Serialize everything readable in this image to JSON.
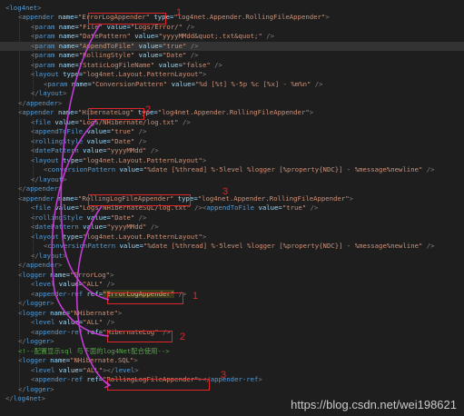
{
  "code_lines": [
    {
      "parts": [
        [
          "t",
          "<"
        ],
        [
          "n",
          "log4net"
        ],
        [
          "t",
          ">"
        ]
      ]
    },
    {
      "parts": [
        [
          "t",
          "<"
        ],
        [
          "n",
          "appender"
        ],
        [
          "a",
          " name="
        ],
        [
          "v",
          "\"ErrorLogAppender\""
        ],
        [
          "a",
          " type="
        ],
        [
          "v",
          "\"log4net.Appender.RollingFileAppender\""
        ],
        [
          "t",
          ">"
        ]
      ]
    },
    {
      "parts": [
        [
          "t",
          "<"
        ],
        [
          "n",
          "param"
        ],
        [
          "a",
          " name="
        ],
        [
          "v",
          "\"File\""
        ],
        [
          "a",
          " value="
        ],
        [
          "v",
          "\"Logs/Error/\""
        ],
        [
          "t",
          " />"
        ]
      ]
    },
    {
      "parts": [
        [
          "t",
          "<"
        ],
        [
          "n",
          "param"
        ],
        [
          "a",
          " name="
        ],
        [
          "v",
          "\"DatePattern\""
        ],
        [
          "a",
          " value="
        ],
        [
          "v",
          "\"yyyyMMdd&quot;.txt&quot;\""
        ],
        [
          "t",
          " />"
        ]
      ]
    },
    {
      "parts": [
        [
          "t",
          "<"
        ],
        [
          "n",
          "param"
        ],
        [
          "a",
          " name="
        ],
        [
          "v",
          "\"AppendToFile\""
        ],
        [
          "a",
          " value="
        ],
        [
          "v",
          "\"true\""
        ],
        [
          "t",
          " />"
        ]
      ]
    },
    {
      "parts": [
        [
          "t",
          "<"
        ],
        [
          "n",
          "param"
        ],
        [
          "a",
          " name="
        ],
        [
          "v",
          "\"RollingStyle\""
        ],
        [
          "a",
          " value="
        ],
        [
          "v",
          "\"Date\""
        ],
        [
          "t",
          " />"
        ]
      ]
    },
    {
      "parts": [
        [
          "t",
          "<"
        ],
        [
          "n",
          "param"
        ],
        [
          "a",
          " name="
        ],
        [
          "v",
          "\"StaticLogFileName\""
        ],
        [
          "a",
          " value="
        ],
        [
          "v",
          "\"false\""
        ],
        [
          "t",
          " />"
        ]
      ]
    },
    {
      "parts": [
        [
          "t",
          "<"
        ],
        [
          "n",
          "layout"
        ],
        [
          "a",
          " type="
        ],
        [
          "v",
          "\"log4net.Layout.PatternLayout\""
        ],
        [
          "t",
          ">"
        ]
      ]
    },
    {
      "parts": [
        [
          "t",
          "<"
        ],
        [
          "n",
          "param"
        ],
        [
          "a",
          " name="
        ],
        [
          "v",
          "\"ConversionPattern\""
        ],
        [
          "a",
          " value="
        ],
        [
          "v",
          "\"%d [%t] %-5p %c [%x] - %m%n\""
        ],
        [
          "t",
          " />"
        ]
      ]
    },
    {
      "parts": [
        [
          "t",
          "</"
        ],
        [
          "n",
          "layout"
        ],
        [
          "t",
          ">"
        ]
      ]
    },
    {
      "parts": [
        [
          "t",
          "</"
        ],
        [
          "n",
          "appender"
        ],
        [
          "t",
          ">"
        ]
      ]
    },
    {
      "parts": [
        [
          "t",
          "<"
        ],
        [
          "n",
          "appender"
        ],
        [
          "a",
          " name="
        ],
        [
          "v",
          "\"HibernateLog\""
        ],
        [
          "a",
          " type="
        ],
        [
          "v",
          "\"log4net.Appender.RollingFileAppender\""
        ],
        [
          "t",
          ">"
        ]
      ]
    },
    {
      "parts": [
        [
          "t",
          "<"
        ],
        [
          "n",
          "file"
        ],
        [
          "a",
          " value="
        ],
        [
          "v",
          "\"Logs/NHibernate/log.txt\""
        ],
        [
          "t",
          " />"
        ]
      ]
    },
    {
      "parts": [
        [
          "t",
          "<"
        ],
        [
          "n",
          "appendToFile"
        ],
        [
          "a",
          " value="
        ],
        [
          "v",
          "\"true\""
        ],
        [
          "t",
          " />"
        ]
      ]
    },
    {
      "parts": [
        [
          "t",
          "<"
        ],
        [
          "n",
          "rollingStyle"
        ],
        [
          "a",
          " value="
        ],
        [
          "v",
          "\"Date\""
        ],
        [
          "t",
          " />"
        ]
      ]
    },
    {
      "parts": [
        [
          "t",
          "<"
        ],
        [
          "n",
          "datePattern"
        ],
        [
          "a",
          " value="
        ],
        [
          "v",
          "\"yyyyMMdd\""
        ],
        [
          "t",
          " />"
        ]
      ]
    },
    {
      "parts": [
        [
          "t",
          "<"
        ],
        [
          "n",
          "layout"
        ],
        [
          "a",
          " type="
        ],
        [
          "v",
          "\"log4net.Layout.PatternLayout\""
        ],
        [
          "t",
          ">"
        ]
      ]
    },
    {
      "parts": [
        [
          "t",
          "<"
        ],
        [
          "n",
          "conversionPattern"
        ],
        [
          "a",
          " value="
        ],
        [
          "v",
          "\"%date [%thread] %-5level %logger [%property{NDC}] - %message%newline\""
        ],
        [
          "t",
          " />"
        ]
      ]
    },
    {
      "parts": [
        [
          "t",
          "</"
        ],
        [
          "n",
          "layout"
        ],
        [
          "t",
          ">"
        ]
      ]
    },
    {
      "parts": [
        [
          "t",
          "</"
        ],
        [
          "n",
          "appender"
        ],
        [
          "t",
          ">"
        ]
      ]
    },
    {
      "parts": [
        [
          "t",
          "<"
        ],
        [
          "n",
          "appender"
        ],
        [
          "a",
          " name="
        ],
        [
          "v",
          "\"RollingLogFileAppender\""
        ],
        [
          "a",
          " type="
        ],
        [
          "v",
          "\"log4net.Appender.RollingFileAppender\""
        ],
        [
          "t",
          ">"
        ]
      ]
    },
    {
      "parts": [
        [
          "t",
          "<"
        ],
        [
          "n",
          "file"
        ],
        [
          "a",
          " value="
        ],
        [
          "v",
          "\"Logs/NHibernateSQL/log.txt\""
        ],
        [
          "t",
          " /><"
        ],
        [
          "n",
          "appendToFile"
        ],
        [
          "a",
          " value="
        ],
        [
          "v",
          "\"true\""
        ],
        [
          "t",
          " />"
        ]
      ]
    },
    {
      "parts": [
        [
          "t",
          "<"
        ],
        [
          "n",
          "rollingStyle"
        ],
        [
          "a",
          " value="
        ],
        [
          "v",
          "\"Date\""
        ],
        [
          "t",
          " />"
        ]
      ]
    },
    {
      "parts": [
        [
          "t",
          "<"
        ],
        [
          "n",
          "datePattern"
        ],
        [
          "a",
          " value="
        ],
        [
          "v",
          "\"yyyyMMdd\""
        ],
        [
          "t",
          " />"
        ]
      ]
    },
    {
      "parts": [
        [
          "t",
          "<"
        ],
        [
          "n",
          "layout"
        ],
        [
          "a",
          " type="
        ],
        [
          "v",
          "\"log4net.Layout.PatternLayout\""
        ],
        [
          "t",
          ">"
        ]
      ]
    },
    {
      "parts": [
        [
          "t",
          "<"
        ],
        [
          "n",
          "conversionPattern"
        ],
        [
          "a",
          " value="
        ],
        [
          "v",
          "\"%date [%thread] %-5level %logger [%property{NDC}] - %message%newline\""
        ],
        [
          "t",
          " />"
        ]
      ]
    },
    {
      "parts": [
        [
          "t",
          "</"
        ],
        [
          "n",
          "layout"
        ],
        [
          "t",
          ">"
        ]
      ]
    },
    {
      "parts": [
        [
          "t",
          "</"
        ],
        [
          "n",
          "appender"
        ],
        [
          "t",
          ">"
        ]
      ]
    },
    {
      "parts": [
        [
          "t",
          "<"
        ],
        [
          "n",
          "logger"
        ],
        [
          "a",
          " name="
        ],
        [
          "v",
          "\"ErrorLog\""
        ],
        [
          "t",
          ">"
        ]
      ]
    },
    {
      "parts": [
        [
          "t",
          "<"
        ],
        [
          "n",
          "level"
        ],
        [
          "a",
          " value="
        ],
        [
          "v",
          "\"ALL\""
        ],
        [
          "t",
          " />"
        ]
      ]
    },
    {
      "parts": [
        [
          "t",
          "<"
        ],
        [
          "n",
          "appender-ref"
        ],
        [
          "a",
          " ref="
        ],
        [
          "hl",
          "\"ErrorLogAppender\""
        ],
        [
          "t",
          " />"
        ]
      ]
    },
    {
      "parts": [
        [
          "t",
          "</"
        ],
        [
          "n",
          "logger"
        ],
        [
          "t",
          ">"
        ]
      ]
    },
    {
      "parts": [
        [
          "t",
          "<"
        ],
        [
          "n",
          "logger"
        ],
        [
          "a",
          " name="
        ],
        [
          "v",
          "\"NHibernate\""
        ],
        [
          "t",
          ">"
        ]
      ]
    },
    {
      "parts": [
        [
          "t",
          "<"
        ],
        [
          "n",
          "level"
        ],
        [
          "a",
          " value="
        ],
        [
          "v",
          "\"ALL\""
        ],
        [
          "t",
          " />"
        ]
      ]
    },
    {
      "parts": [
        [
          "t",
          "<"
        ],
        [
          "n",
          "appender-ref"
        ],
        [
          "a",
          " ref="
        ],
        [
          "v",
          "\"HibernateLog\""
        ],
        [
          "t",
          " />"
        ]
      ]
    },
    {
      "parts": [
        [
          "t",
          "</"
        ],
        [
          "n",
          "logger"
        ],
        [
          "t",
          ">"
        ]
      ]
    },
    {
      "parts": [
        [
          "c",
          "<!--配置显示sql 与下面的log4Net配合使用-->"
        ]
      ]
    },
    {
      "parts": [
        [
          "t",
          "<"
        ],
        [
          "n",
          "logger"
        ],
        [
          "a",
          " name="
        ],
        [
          "v",
          "\"NHibernate.SQL\""
        ],
        [
          "t",
          ">"
        ]
      ]
    },
    {
      "parts": [
        [
          "t",
          "<"
        ],
        [
          "n",
          "level"
        ],
        [
          "a",
          " value="
        ],
        [
          "v",
          "\"ALL\""
        ],
        [
          "t",
          "></"
        ],
        [
          "n",
          "level"
        ],
        [
          "t",
          ">"
        ]
      ]
    },
    {
      "parts": [
        [
          "t",
          "<"
        ],
        [
          "n",
          "appender-ref"
        ],
        [
          "a",
          " ref="
        ],
        [
          "v",
          "\"RollingLogFileAppender\""
        ],
        [
          "t",
          "></"
        ],
        [
          "n",
          "appender-ref"
        ],
        [
          "t",
          ">"
        ]
      ]
    },
    {
      "parts": [
        [
          "t",
          "</"
        ],
        [
          "n",
          "logger"
        ],
        [
          "t",
          ">"
        ]
      ]
    },
    {
      "parts": [
        [
          "t",
          "</"
        ],
        [
          "n",
          "log4net"
        ],
        [
          "t",
          ">"
        ]
      ]
    }
  ],
  "annotations": {
    "number_1a": "1",
    "number_2a": "2",
    "number_3a": "3",
    "number_1b": "1",
    "number_2b": "2",
    "number_3b": "3"
  },
  "watermark": "https://blog.csdn.net/wei198621",
  "colors": {
    "background": "#1e1e1e",
    "annotation": "#e0262b",
    "highlight": "#d7ba7d"
  }
}
